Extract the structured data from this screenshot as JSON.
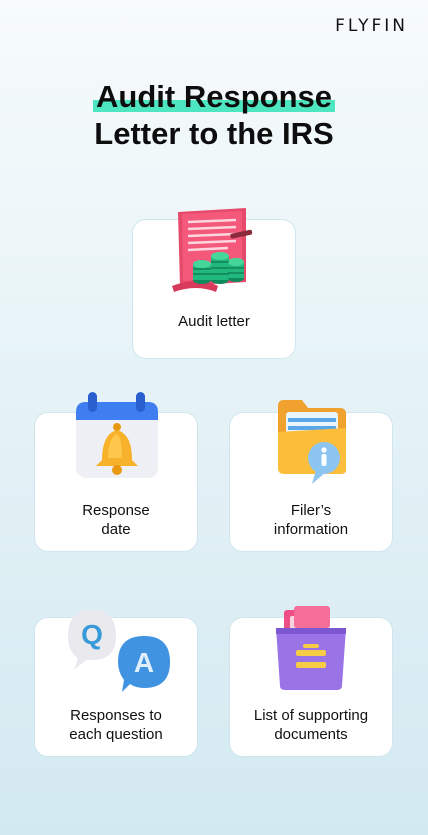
{
  "brand": {
    "logo": "FLYFIN"
  },
  "header": {
    "title_line1": "Audit Response",
    "title_line2": "Letter to the IRS",
    "highlight_color": "#4ee6c0"
  },
  "cards": [
    {
      "label": "Audit letter",
      "icon": "audit-letter-icon"
    },
    {
      "label": "Response\ndate",
      "icon": "calendar-bell-icon"
    },
    {
      "label": "Filer’s\ninformation",
      "icon": "folder-info-icon"
    },
    {
      "label": "Responses to\neach question",
      "icon": "qa-bubbles-icon"
    },
    {
      "label": "List of supporting\ndocuments",
      "icon": "document-box-icon"
    }
  ]
}
